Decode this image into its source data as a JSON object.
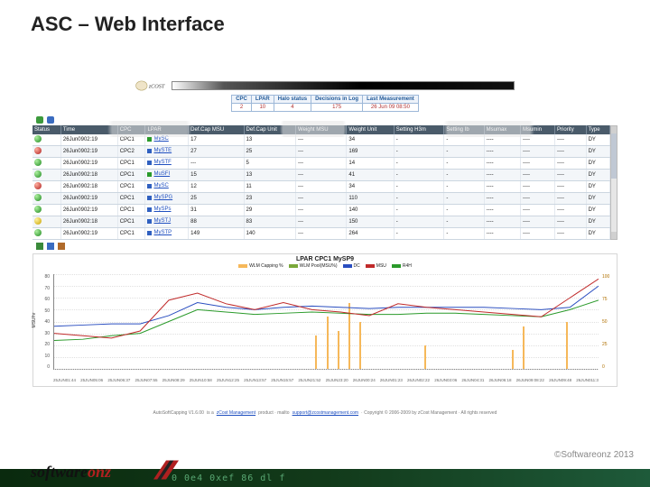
{
  "title": "ASC – Web Interface",
  "logo_text": "zCOST",
  "summary": {
    "headers": [
      "CPC",
      "LPAR",
      "Halo status",
      "Decisions in Log",
      "Last Measurement"
    ],
    "values": [
      "2",
      "10",
      "4",
      "175",
      "26 Jun 09 08:50"
    ]
  },
  "toolbar_icons": [
    "refresh-icon",
    "settings-icon"
  ],
  "grid": {
    "headers": [
      "Status",
      "Time",
      "CPC",
      "LPAR",
      "Def.Cap MSU",
      "Def.Cap Unit",
      "Weight MSU",
      "Weight Unit",
      "Setting H3m",
      "Setting Ib",
      "Msumax",
      "Msumin",
      "Priority",
      "Type"
    ],
    "rows": [
      {
        "status": "green",
        "time": "26Jun0902:19",
        "cpc": "CPC1",
        "lpar": "MySC",
        "lcolor": "g",
        "defcap": "17",
        "defunit": "13",
        "wmsu": "---",
        "wunit": "34",
        "s1": "-",
        "s2": "-",
        "mx": "----",
        "mn": "----",
        "pri": "----",
        "type": "DY"
      },
      {
        "status": "red",
        "time": "26Jun0902:19",
        "cpc": "CPC2",
        "lpar": "MySTE",
        "lcolor": "b",
        "defcap": "27",
        "defunit": "25",
        "wmsu": "---",
        "wunit": "169",
        "s1": "-",
        "s2": "-",
        "mx": "----",
        "mn": "----",
        "pri": "----",
        "type": "DY"
      },
      {
        "status": "green",
        "time": "26Jun0902:19",
        "cpc": "CPC1",
        "lpar": "MySTF",
        "lcolor": "b",
        "defcap": "---",
        "defunit": "5",
        "wmsu": "---",
        "wunit": "14",
        "s1": "-",
        "s2": "-",
        "mx": "----",
        "mn": "----",
        "pri": "----",
        "type": "DY"
      },
      {
        "status": "green",
        "time": "26Jun0902:18",
        "cpc": "CPC1",
        "lpar": "MuSFI",
        "lcolor": "g",
        "defcap": "15",
        "defunit": "13",
        "wmsu": "---",
        "wunit": "41",
        "s1": "-",
        "s2": "-",
        "mx": "----",
        "mn": "----",
        "pri": "----",
        "type": "DY"
      },
      {
        "status": "red",
        "time": "26Jun0902:18",
        "cpc": "CPC1",
        "lpar": "MySC",
        "lcolor": "b",
        "defcap": "12",
        "defunit": "11",
        "wmsu": "---",
        "wunit": "34",
        "s1": "-",
        "s2": "-",
        "mx": "----",
        "mn": "----",
        "pri": "----",
        "type": "DY"
      },
      {
        "status": "green",
        "time": "26Jun0902:19",
        "cpc": "CPC1",
        "lpar": "MySPG",
        "lcolor": "b",
        "defcap": "25",
        "defunit": "23",
        "wmsu": "---",
        "wunit": "110",
        "s1": "-",
        "s2": "-",
        "mx": "----",
        "mn": "----",
        "pri": "----",
        "type": "DY"
      },
      {
        "status": "green",
        "time": "26Jun0902:19",
        "cpc": "CPC1",
        "lpar": "MySPs",
        "lcolor": "b",
        "defcap": "31",
        "defunit": "29",
        "wmsu": "---",
        "wunit": "140",
        "s1": "-",
        "s2": "-",
        "mx": "----",
        "mn": "----",
        "pri": "----",
        "type": "DY"
      },
      {
        "status": "yellow",
        "time": "26Jun0902:18",
        "cpc": "CPC1",
        "lpar": "MySTJ",
        "lcolor": "b",
        "defcap": "88",
        "defunit": "83",
        "wmsu": "---",
        "wunit": "150",
        "s1": "-",
        "s2": "-",
        "mx": "----",
        "mn": "----",
        "pri": "----",
        "type": "DY"
      },
      {
        "status": "green",
        "time": "26Jun0902:19",
        "cpc": "CPC1",
        "lpar": "MySTP",
        "lcolor": "b",
        "defcap": "149",
        "defunit": "140",
        "wmsu": "---",
        "wunit": "264",
        "s1": "-",
        "s2": "-",
        "mx": "----",
        "mn": "----",
        "pri": "----",
        "type": "DY"
      }
    ]
  },
  "chart_toolbar": [
    "export-icon",
    "refresh-icon",
    "print-icon"
  ],
  "footer": {
    "product": "AutoSoftCapping V1.6.00",
    "is_a": " is a ",
    "brand": "zCost Management",
    "product2": " product · mailto ",
    "mail": "support@zcostmanagement.com",
    "copy": " · Copyright © 2006-2009 by zCost Management · All rights reserved"
  },
  "copyright": "©Softwareonz 2013",
  "chart_data": {
    "type": "line",
    "title": "LPAR CPC1 MySP9",
    "ylabel": "MSU/hr",
    "ylim_left": [
      0,
      80
    ],
    "yticks_left": [
      0,
      10,
      20,
      30,
      40,
      50,
      60,
      70,
      80
    ],
    "ylim_right": [
      0,
      100
    ],
    "yticks_right": [
      0,
      25,
      50,
      75,
      100
    ],
    "x_labels": [
      "25JUN01:44",
      "25JUN05:06",
      "25JUN06:37",
      "25JUN07:55",
      "25JUN08:29",
      "25JUN10:58",
      "25JUN12:25",
      "25JUN13:57",
      "25JUN15:57",
      "25JUN21:52",
      "25JUN23:20",
      "26JUN00:24",
      "26JUN01:23",
      "26JUN02:22",
      "26JUN03:06",
      "26JUN04:31",
      "26JUN06:18",
      "26JUN09:08:22",
      "26JUN09:48",
      "26JUN011:3"
    ],
    "legend": [
      {
        "name": "WLM Capping %",
        "color": "#f6b85a"
      },
      {
        "name": "WLM Pool(MSU%)",
        "color": "#7aa83a"
      },
      {
        "name": "DC",
        "color": "#2a4ec0"
      },
      {
        "name": "MSU",
        "color": "#c02a2a"
      },
      {
        "name": "R4H",
        "color": "#2a9a2a"
      }
    ],
    "bars": {
      "name": "WLM Capping %",
      "x_pct": [
        48,
        50,
        52,
        54,
        56,
        68,
        84,
        86,
        94
      ],
      "h_pct": [
        35,
        55,
        40,
        70,
        50,
        25,
        20,
        45,
        50
      ]
    },
    "series": [
      {
        "name": "DC",
        "color": "#2a4ec0",
        "y": [
          36,
          37,
          38,
          38,
          45,
          56,
          52,
          50,
          52,
          53,
          52,
          51,
          52,
          52,
          52,
          52,
          51,
          50,
          52,
          70
        ]
      },
      {
        "name": "R4H",
        "color": "#2a9a2a",
        "y": [
          24,
          25,
          28,
          30,
          40,
          50,
          48,
          46,
          47,
          48,
          47,
          46,
          46,
          47,
          47,
          46,
          45,
          44,
          50,
          58
        ]
      },
      {
        "name": "MSU",
        "color": "#c02a2a",
        "y": [
          30,
          28,
          26,
          32,
          58,
          64,
          55,
          50,
          56,
          50,
          48,
          45,
          55,
          52,
          50,
          48,
          46,
          44,
          60,
          76
        ]
      }
    ]
  },
  "brand": {
    "part1": "software",
    "part2": "onz"
  },
  "hexstrip": "0 0e4 0xef 86     dl f"
}
